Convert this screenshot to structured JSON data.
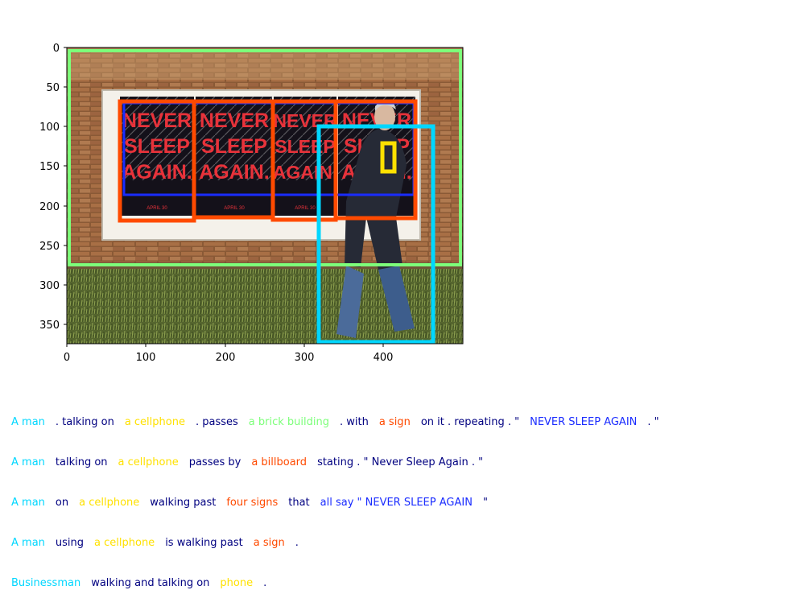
{
  "axes": {
    "y_ticks": [
      "0",
      "50",
      "100",
      "150",
      "200",
      "250",
      "300",
      "350"
    ],
    "x_ticks": [
      "0",
      "100",
      "200",
      "300",
      "400"
    ]
  },
  "photo": {
    "poster_text": [
      "NEVER",
      "SLEEP",
      "AGAIN."
    ],
    "poster_date": "APRIL 30"
  },
  "regions": [
    {
      "id": "brick-building",
      "color": "#7dff7a"
    },
    {
      "id": "sign-group",
      "color": "#1a2cff"
    },
    {
      "id": "sign-1",
      "color": "#ff4a00"
    },
    {
      "id": "sign-2",
      "color": "#ff4a00"
    },
    {
      "id": "sign-3",
      "color": "#ff4a00"
    },
    {
      "id": "sign-4",
      "color": "#ff4a00"
    },
    {
      "id": "man",
      "color": "#00d7ff"
    },
    {
      "id": "cellphone",
      "color": "#ffe100"
    }
  ],
  "colors": {
    "man": "#00d7ff",
    "phone": "#ffe100",
    "building": "#7dff7a",
    "sign": "#ff4a00",
    "group": "#1a2cff",
    "text": "#000080"
  },
  "captions": [
    [
      {
        "t": "A man",
        "c": "man"
      },
      {
        "t": ". talking on",
        "c": "text"
      },
      {
        "t": "a cellphone",
        "c": "phone"
      },
      {
        "t": ". passes",
        "c": "text"
      },
      {
        "t": "a brick building",
        "c": "building"
      },
      {
        "t": ". with",
        "c": "text"
      },
      {
        "t": "a sign",
        "c": "sign"
      },
      {
        "t": "on it . repeating . \"",
        "c": "text"
      },
      {
        "t": "NEVER SLEEP AGAIN",
        "c": "group"
      },
      {
        "t": ". \"",
        "c": "text"
      }
    ],
    [
      {
        "t": "A man",
        "c": "man"
      },
      {
        "t": "talking on",
        "c": "text"
      },
      {
        "t": "a cellphone",
        "c": "phone"
      },
      {
        "t": "passes by",
        "c": "text"
      },
      {
        "t": "a billboard",
        "c": "sign"
      },
      {
        "t": "stating . \" Never Sleep Again . \"",
        "c": "text"
      }
    ],
    [
      {
        "t": "A man",
        "c": "man"
      },
      {
        "t": "on",
        "c": "text"
      },
      {
        "t": "a cellphone",
        "c": "phone"
      },
      {
        "t": "walking past",
        "c": "text"
      },
      {
        "t": "four signs",
        "c": "sign"
      },
      {
        "t": "that",
        "c": "text"
      },
      {
        "t": "all say \" NEVER SLEEP AGAIN",
        "c": "group"
      },
      {
        "t": "\"",
        "c": "text"
      }
    ],
    [
      {
        "t": "A man",
        "c": "man"
      },
      {
        "t": "using",
        "c": "text"
      },
      {
        "t": "a cellphone",
        "c": "phone"
      },
      {
        "t": "is walking past",
        "c": "text"
      },
      {
        "t": "a sign",
        "c": "sign"
      },
      {
        "t": ".",
        "c": "text"
      }
    ],
    [
      {
        "t": "Businessman",
        "c": "man"
      },
      {
        "t": "walking and talking on",
        "c": "text"
      },
      {
        "t": "phone",
        "c": "phone"
      },
      {
        "t": ".",
        "c": "text"
      }
    ]
  ]
}
